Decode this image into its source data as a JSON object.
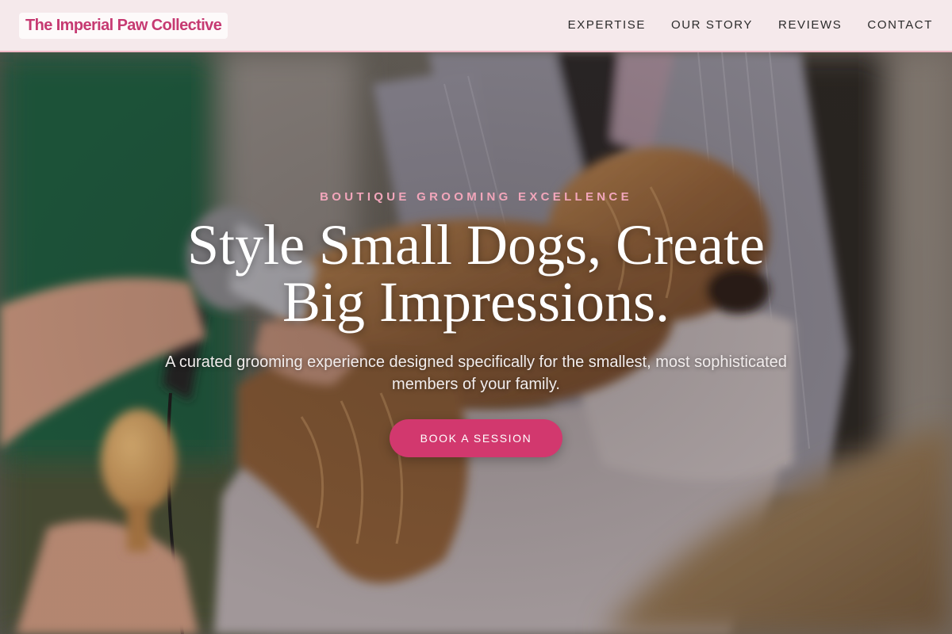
{
  "brand": {
    "name": "The Imperial Paw Collective",
    "accent_color": "#c63a72",
    "eyebrow_color": "#f2a6bb",
    "button_color": "#d2386e"
  },
  "nav": {
    "items": [
      {
        "label": "EXPERTISE"
      },
      {
        "label": "OUR STORY"
      },
      {
        "label": "REVIEWS"
      },
      {
        "label": "CONTACT"
      }
    ]
  },
  "hero": {
    "eyebrow": "BOUTIQUE GROOMING EXCELLENCE",
    "title": "Style Small Dogs, Create Big Impressions.",
    "subtitle": "A curated grooming experience designed specifically for the smallest, most sophisticated members of your family.",
    "cta_label": "BOOK A SESSION",
    "background_image": "photo of a groomer blow-drying a small long-haired dog wrapped in a towel"
  }
}
